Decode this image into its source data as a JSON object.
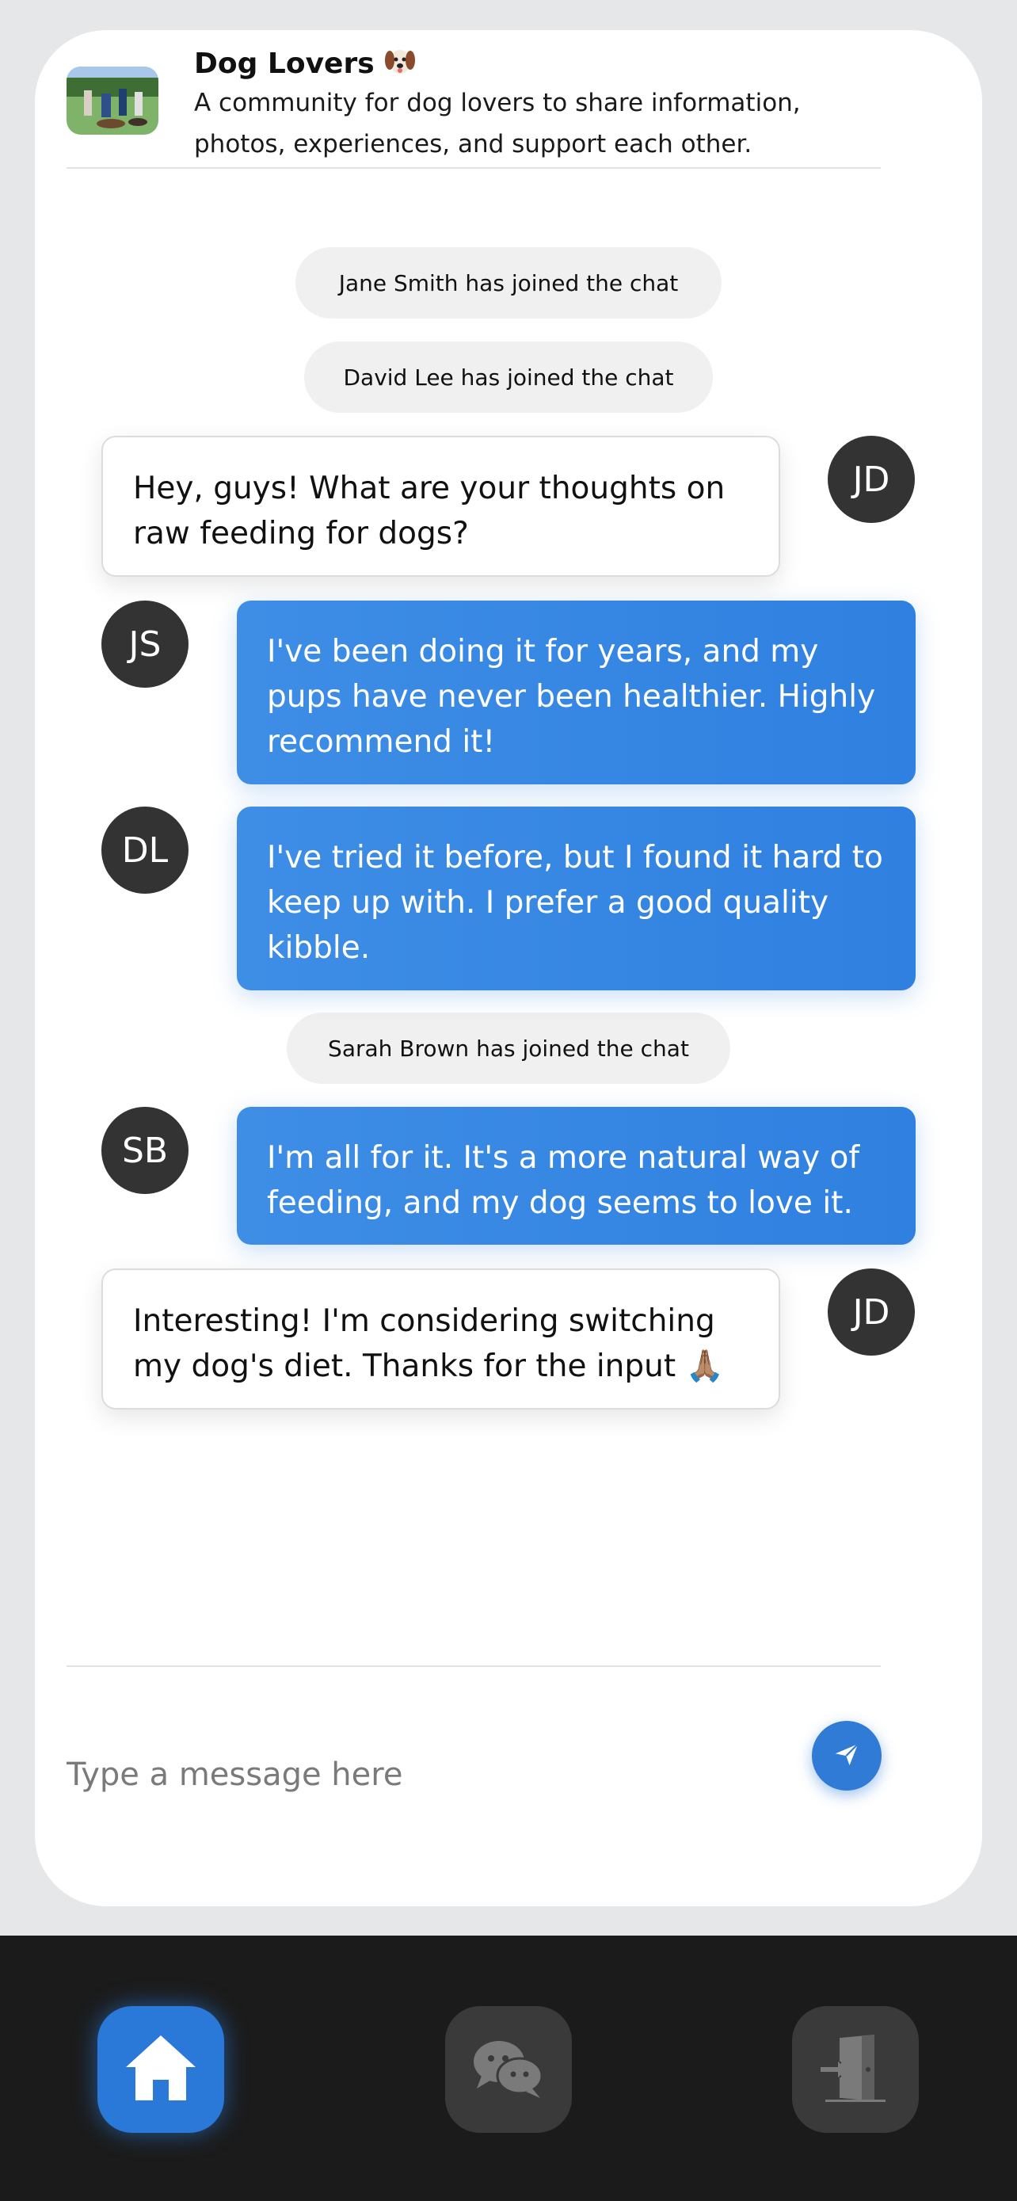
{
  "group": {
    "title": "Dog Lovers",
    "description": "A community for dog lovers to share information, photos, experiences, and support each other."
  },
  "system_messages": [
    "Jane Smith has joined the chat",
    "David Lee has joined the chat",
    "Sarah Brown has joined the chat"
  ],
  "messages": [
    {
      "initials": "JD",
      "text": "Hey, guys! What are your thoughts on raw feeding for dogs?"
    },
    {
      "initials": "JS",
      "text": "I've been doing it for years, and my pups have never been healthier. Highly recommend it!"
    },
    {
      "initials": "DL",
      "text": "I've tried it before, but I found it hard to keep up with. I prefer a good quality kibble."
    },
    {
      "initials": "SB",
      "text": "I'm all for it. It's a more natural way of feeding, and my dog seems to love it."
    },
    {
      "initials": "JD",
      "text": "Interesting! I'm considering switching my dog's diet. Thanks for the input 🙏🏽"
    }
  ],
  "composer": {
    "placeholder": "Type a message here"
  },
  "colors": {
    "accent": "#2f80e0",
    "avatar": "#333333",
    "nav_background": "#1b1b1b"
  },
  "icons": [
    "dog-face-icon",
    "send-icon",
    "home-icon",
    "chat-icon",
    "exit-door-icon"
  ]
}
